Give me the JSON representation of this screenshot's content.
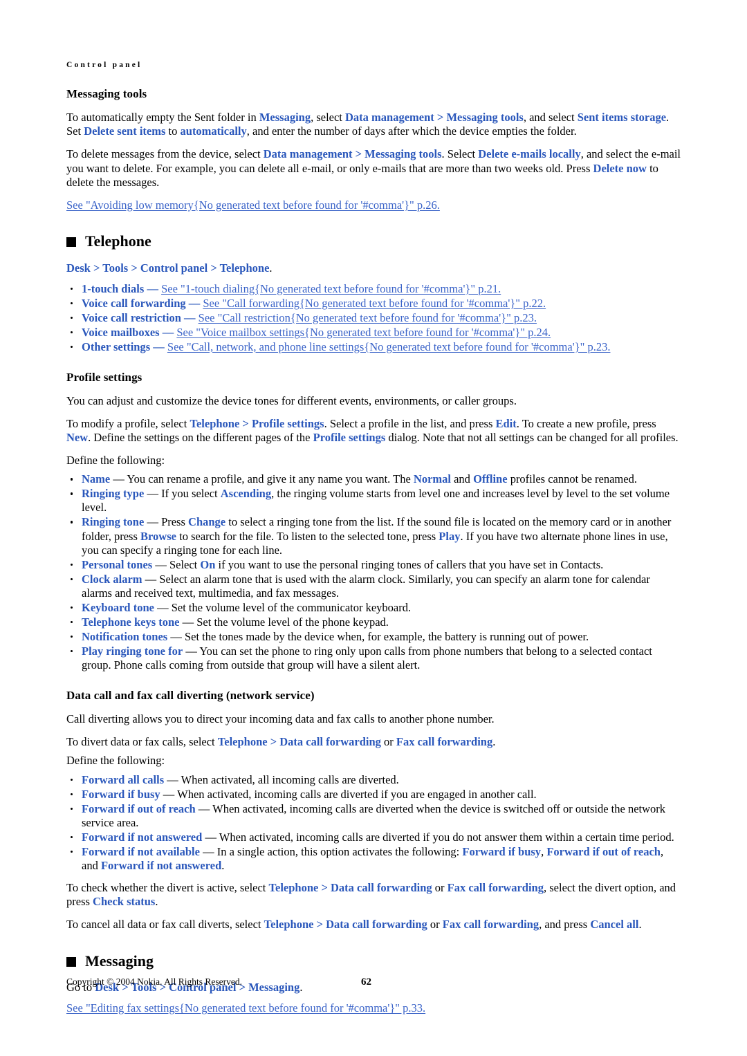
{
  "page": {
    "running_head": "Control panel",
    "page_number": "62",
    "copyright": "Copyright © 2004 Nokia. All Rights Reserved.",
    "link_color": "#2a57bb",
    "see_link_color": "#3a63c8"
  },
  "messaging_tools": {
    "heading": "Messaging tools",
    "p1": {
      "t1": "To automatically empty the Sent folder in ",
      "l1": "Messaging",
      "t2": ", select ",
      "l2": "Data management",
      "gt1": " > ",
      "l3": "Messaging tools",
      "t3": ", and select ",
      "l4": "Sent items storage",
      "t4": ". Set ",
      "l5": "Delete sent items",
      "t5": " to ",
      "l6": "automatically",
      "t6": ", and enter the number of days after which the device empties the folder."
    },
    "p2": {
      "t1": "To delete messages from the device, select ",
      "l1": "Data management",
      "gt1": " > ",
      "l2": "Messaging tools",
      "t2": ". Select ",
      "l3": "Delete e-mails locally",
      "t3": ", and select the e-mail you want to delete. For example, you can delete all e-mail, or only e-mails that are more than two weeks old. Press ",
      "l4": "Delete now",
      "t4": " to delete the messages."
    },
    "see1": "See \"Avoiding low memory{No generated text before found for '#comma'}\" p.26."
  },
  "telephone": {
    "heading": "Telephone",
    "breadcrumb": {
      "b1": "Desk",
      "gt1": " > ",
      "b2": "Tools",
      "gt2": " > ",
      "b3": "Control panel",
      "gt3": " > ",
      "b4": "Telephone",
      "end": "."
    },
    "items": [
      {
        "term": "1-touch dials",
        "dash": " — ",
        "see": "See \"1-touch dialing{No generated text before found for '#comma'}\" p.21."
      },
      {
        "term": "Voice call forwarding",
        "dash": " — ",
        "see": "See \"Call forwarding{No generated text before found for '#comma'}\" p.22."
      },
      {
        "term": "Voice call restriction",
        "dash": " — ",
        "see": "See \"Call restriction{No generated text before found for '#comma'}\" p.23."
      },
      {
        "term": "Voice mailboxes",
        "dash": " — ",
        "see": "See \"Voice mailbox settings{No generated text before found for '#comma'}\" p.24."
      },
      {
        "term": "Other settings",
        "dash": " — ",
        "see": "See \"Call, network, and phone line settings{No generated text before found for '#comma'}\" p.23."
      }
    ]
  },
  "profile_settings": {
    "heading": "Profile settings",
    "p1": "You can adjust and customize the device tones for different events, environments, or caller groups.",
    "p2": {
      "t1": "To modify a profile, select ",
      "l1": "Telephone",
      "gt1": " > ",
      "l2": "Profile settings",
      "t2": ". Select a profile in the list, and press ",
      "l3": "Edit",
      "t3": ". To create a new profile, press ",
      "l4": "New",
      "t4": ". Define the settings on the different pages of the ",
      "l5": "Profile settings",
      "t5": " dialog. Note that not all settings can be changed for all profiles."
    },
    "define": "Define the following:",
    "items": [
      {
        "term": "Name",
        "dash": " — ",
        "t1": "You can rename a profile, and give it any name you want. The ",
        "l1": "Normal",
        "t2": " and ",
        "l2": "Offline",
        "t3": " profiles cannot be renamed."
      },
      {
        "term": "Ringing type",
        "dash": " — ",
        "t1": "If you select ",
        "l1": "Ascending",
        "t2": ", the ringing volume starts from level one and increases level by level to the set volume level."
      },
      {
        "term": "Ringing tone",
        "dash": " — ",
        "t1": "Press ",
        "l1": "Change",
        "t2": " to select a ringing tone from the list. If the sound file is located on the memory card or in another folder, press ",
        "l2": "Browse",
        "t3": " to search for the file. To listen to the selected tone, press ",
        "l3": "Play",
        "t4": ". If you have two alternate phone lines in use, you can specify a ringing tone for each line."
      },
      {
        "term": "Personal tones",
        "dash": " — ",
        "t1": "Select ",
        "l1": "On",
        "t2": " if you want to use the personal ringing tones of callers that you have set in Contacts."
      },
      {
        "term": "Clock alarm",
        "dash": " — ",
        "t1": "Select an alarm tone that is used with the alarm clock. Similarly, you can specify an alarm tone for calendar alarms and received text, multimedia, and fax messages."
      },
      {
        "term": "Keyboard tone",
        "dash": " — ",
        "t1": "Set the volume level of the communicator keyboard."
      },
      {
        "term": "Telephone keys tone",
        "dash": " — ",
        "t1": "Set the volume level of the phone keypad."
      },
      {
        "term": "Notification tones",
        "dash": " — ",
        "t1": "Set the tones made by the device when, for example, the battery is running out of power."
      },
      {
        "term": "Play ringing tone for",
        "dash": " — ",
        "t1": "You can set the phone to ring only upon calls from phone numbers that belong to a selected contact group. Phone calls coming from outside that group will have a silent alert."
      }
    ]
  },
  "data_fax_diverting": {
    "heading": "Data call and fax call diverting (network service)",
    "p1": "Call diverting allows you to direct your incoming data and fax calls to another phone number.",
    "p2": {
      "t1": "To divert data or fax calls, select ",
      "l1": "Telephone",
      "gt1": " > ",
      "l2": "Data call forwarding",
      "t2": " or ",
      "l3": "Fax call forwarding",
      "t3": "."
    },
    "define": "Define the following:",
    "items": [
      {
        "term": "Forward all calls",
        "dash": " — ",
        "t1": "When activated, all incoming calls are diverted."
      },
      {
        "term": "Forward if busy",
        "dash": " — ",
        "t1": "When activated, incoming calls are diverted if you are engaged in another call."
      },
      {
        "term": "Forward if out of reach",
        "dash": " — ",
        "t1": "When activated, incoming calls are diverted when the device is switched off or outside the network service area."
      },
      {
        "term": "Forward if not answered",
        "dash": " — ",
        "t1": "When activated, incoming calls are diverted if you do not answer them within a certain time period."
      },
      {
        "term": "Forward if not available",
        "dash": " — ",
        "t1": "In a single action, this option activates the following: ",
        "l1": "Forward if busy",
        "t2": ", ",
        "l2": "Forward if out of reach",
        "t3": ", and ",
        "l3": "Forward if not answered",
        "t4": "."
      }
    ],
    "p3": {
      "t1": "To check whether the divert is active, select ",
      "l1": "Telephone",
      "gt1": " > ",
      "l2": "Data call forwarding",
      "t2": " or ",
      "l3": "Fax call forwarding",
      "t3": ", select the divert option, and press ",
      "l4": "Check status",
      "t4": "."
    },
    "p4": {
      "t1": "To cancel all data or fax call diverts, select ",
      "l1": "Telephone",
      "gt1": " > ",
      "l2": "Data call forwarding",
      "t2": " or ",
      "l3": "Fax call forwarding",
      "t3": ", and press ",
      "l4": "Cancel all",
      "t4": "."
    }
  },
  "messaging": {
    "heading": "Messaging",
    "breadcrumb": {
      "pre": "Go to ",
      "b1": "Desk",
      "gt1": " > ",
      "b2": "Tools",
      "gt2": " > ",
      "b3": "Control panel",
      "gt3": " > ",
      "b4": "Messaging",
      "end": "."
    },
    "see1": "See \"Editing fax settings{No generated text before found for '#comma'}\" p.33."
  }
}
